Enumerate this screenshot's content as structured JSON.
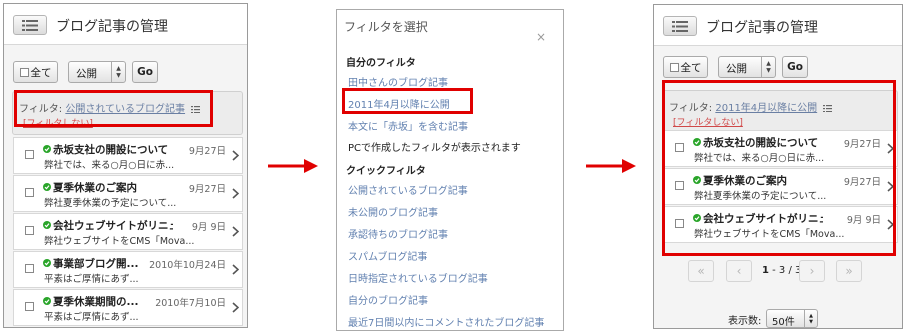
{
  "colors": {
    "highlight": "#e00000",
    "link": "#6281b0",
    "status_ok": "#2aa52a"
  },
  "panel1": {
    "header_title": "ブログ記事の管理",
    "all_label": "全て",
    "status_select": "公開",
    "go_label": "Go",
    "filter_prefix": "フィルタ:",
    "filter_value": "公開されているブログ記事",
    "no_filter": "[フィルタしない]",
    "items": [
      {
        "title": "赤坂支社の開設について",
        "date": "9月27日",
        "snippet": "弊社では、来る○月○日に赤..."
      },
      {
        "title": "夏季休業のご案内",
        "date": "9月27日",
        "snippet": "弊社夏季休業の予定について..."
      },
      {
        "title": "会社ウェブサイトがリニュ...",
        "date": "9月 9日",
        "snippet": "弊社ウェブサイトをCMS「Mova..."
      },
      {
        "title": "事業部ブログ開...",
        "date": "2010年10月24日",
        "snippet": "平素はご厚情にあず..."
      },
      {
        "title": "夏季休業期間の...",
        "date": "2010年7月10日",
        "snippet": "平素はご厚情にあず..."
      }
    ]
  },
  "panel2": {
    "title": "フィルタを選択",
    "close": "×",
    "my_filters_heading": "自分のフィルタ",
    "my_filters": [
      "田中さんのブログ記事",
      "2011年4月以降に公開",
      "本文に「赤坂」を含む記事"
    ],
    "note": "PCで作成したフィルタが表示されます",
    "quick_heading": "クイックフィルタ",
    "quick_filters": [
      "公開されているブログ記事",
      "未公開のブログ記事",
      "承認待ちのブログ記事",
      "スパムブログ記事",
      "日時指定されているブログ記事",
      "自分のブログ記事",
      "最近7日間以内にコメントされたブログ記事"
    ]
  },
  "panel3": {
    "header_title": "ブログ記事の管理",
    "all_label": "全て",
    "status_select": "公開",
    "go_label": "Go",
    "filter_prefix": "フィルタ:",
    "filter_value": "2011年4月以降に公開",
    "no_filter": "[フィルタしない]",
    "items": [
      {
        "title": "赤坂支社の開設について",
        "date": "9月27日",
        "snippet": "弊社では、来る○月○日に赤..."
      },
      {
        "title": "夏季休業のご案内",
        "date": "9月27日",
        "snippet": "弊社夏季休業の予定について..."
      },
      {
        "title": "会社ウェブサイトがリニュ...",
        "date": "9月 9日",
        "snippet": "弊社ウェブサイトをCMS「Mova..."
      }
    ],
    "pager": {
      "first": "«",
      "prev": "‹",
      "current": "1",
      "range_rest": " - 3 / 3",
      "next": "›",
      "last": "»"
    },
    "page_size_label": "表示数:",
    "page_size_value": "50件"
  }
}
